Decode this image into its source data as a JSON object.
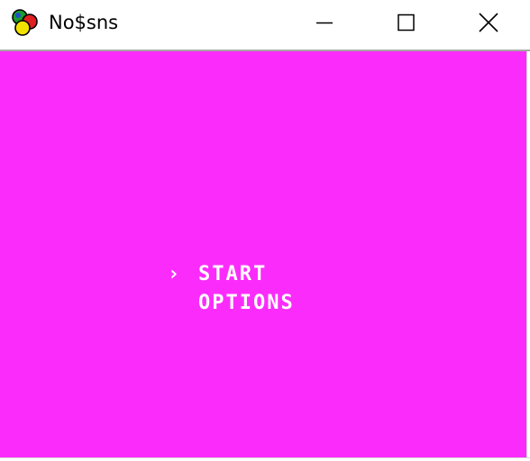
{
  "window": {
    "title": "No$sns",
    "icon": "no-sns-app-icon"
  },
  "title_bar": {
    "buttons": [
      "minimize",
      "maximize",
      "close"
    ]
  },
  "colors": {
    "game_background": "#fb2cfb",
    "menu_text": "#ffffff"
  },
  "game": {
    "cursor": "›",
    "menu": {
      "selected_index": 0,
      "items": [
        "START",
        "OPTIONS"
      ]
    }
  }
}
